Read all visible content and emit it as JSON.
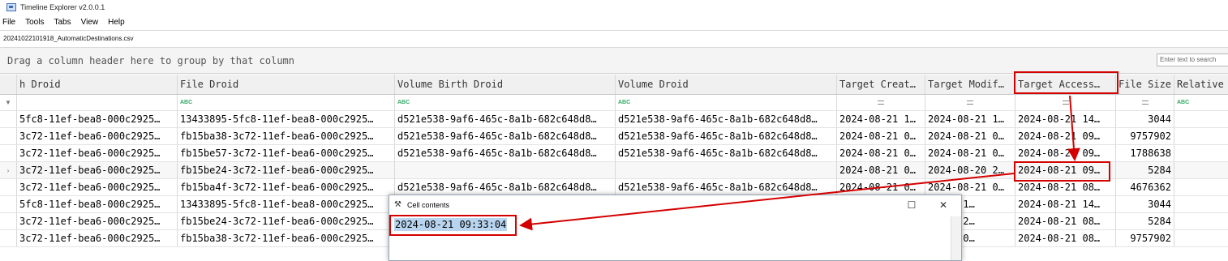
{
  "window": {
    "title": "Timeline Explorer v2.0.0.1"
  },
  "menu": [
    "File",
    "Tools",
    "Tabs",
    "View",
    "Help"
  ],
  "tab": {
    "label": "20241022101918_AutomaticDestinations.csv"
  },
  "groupbar": {
    "hint": "Drag a column header here to group by that column",
    "search_placeholder": "Enter text to search"
  },
  "grid": {
    "columns": [
      "h Droid",
      "File Droid",
      "Volume Birth Droid",
      "Volume Droid",
      "Target Creat…",
      "Target Modif…",
      "Target Access…",
      "File Size",
      "Relative"
    ],
    "filter_icons": [
      "",
      "abc",
      "abc",
      "abc",
      "eq",
      "eq",
      "eq",
      "eq",
      "abc"
    ],
    "rows": [
      [
        "5fc8-11ef-bea8-000c2925…",
        "13433895-5fc8-11ef-bea8-000c2925…",
        "d521e538-9af6-465c-8a1b-682c648d8…",
        "d521e538-9af6-465c-8a1b-682c648d8…",
        "2024-08-21 1…",
        "2024-08-21 1…",
        "2024-08-21 14…",
        "3044",
        ""
      ],
      [
        "3c72-11ef-bea6-000c2925…",
        "fb15ba38-3c72-11ef-bea6-000c2925…",
        "d521e538-9af6-465c-8a1b-682c648d8…",
        "d521e538-9af6-465c-8a1b-682c648d8…",
        "2024-08-21 0…",
        "2024-08-21 0…",
        "2024-08-21 09…",
        "9757902",
        ""
      ],
      [
        "3c72-11ef-bea6-000c2925…",
        "fb15be57-3c72-11ef-bea6-000c2925…",
        "d521e538-9af6-465c-8a1b-682c648d8…",
        "d521e538-9af6-465c-8a1b-682c648d8…",
        "2024-08-21 0…",
        "2024-08-21 0…",
        "2024-08-21 09…",
        "1788638",
        ""
      ],
      [
        "3c72-11ef-bea6-000c2925…",
        "fb15be24-3c72-11ef-bea6-000c2925…",
        "",
        "",
        "2024-08-21 0…",
        "2024-08-20 2…",
        "2024-08-21 09…",
        "5284",
        ""
      ],
      [
        "3c72-11ef-bea6-000c2925…",
        "fb15ba4f-3c72-11ef-bea6-000c2925…",
        "d521e538-9af6-465c-8a1b-682c648d8…",
        "d521e538-9af6-465c-8a1b-682c648d8…",
        "2024-08-21 0…",
        "2024-08-21 0…",
        "2024-08-21 08…",
        "4676362",
        ""
      ],
      [
        "5fc8-11ef-bea8-000c2925…",
        "13433895-5fc8-11ef-bea8-000c2925…",
        "",
        "",
        "",
        "08-21 1…",
        "2024-08-21 14…",
        "3044",
        ""
      ],
      [
        "3c72-11ef-bea6-000c2925…",
        "fb15be24-3c72-11ef-bea6-000c2925…",
        "",
        "",
        "",
        "08-20 2…",
        "2024-08-21 08…",
        "5284",
        ""
      ],
      [
        "3c72-11ef-bea6-000c2925…",
        "fb15ba38-3c72-11ef-bea6-000c2925…",
        "",
        "",
        "",
        "08-21 0…",
        "2024-08-21 08…",
        "9757902",
        ""
      ]
    ],
    "row_indicator": "›"
  },
  "popup": {
    "title": "Cell contents",
    "icon": "tool-icon",
    "value": "2024-08-21 09:33:04",
    "minimize": "☐",
    "close": "✕"
  },
  "colors": {
    "callout": "#d40000"
  }
}
